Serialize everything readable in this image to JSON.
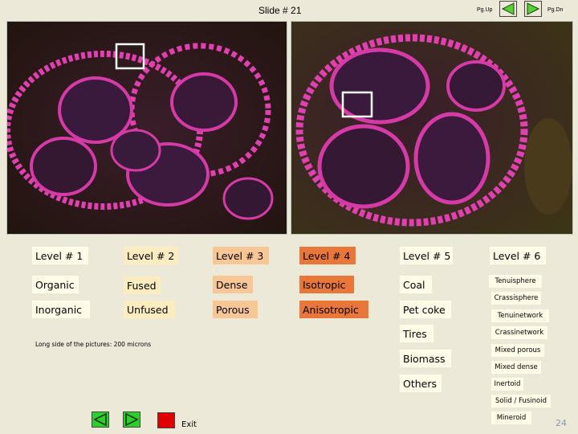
{
  "slide_title": "Slide  # 21",
  "nav": {
    "pgup_label": "Pg.Up",
    "pgdn_label": "Pg.Dn",
    "exit_label": "Exit"
  },
  "levels": [
    {
      "header": "Level # 1",
      "items": [
        "Organic",
        "Inorganic"
      ]
    },
    {
      "header": "Level # 2",
      "items": [
        "Fused",
        "Unfused"
      ]
    },
    {
      "header": "Level # 3",
      "items": [
        "Dense",
        "Porous"
      ]
    },
    {
      "header": "Level # 4",
      "items": [
        "Isotropic",
        "Anisotropic"
      ]
    },
    {
      "header": "Level # 5",
      "items": [
        "Coal",
        "Pet coke",
        "Tires",
        "Biomass",
        "Others"
      ]
    },
    {
      "header": "Level # 6",
      "items": [
        "Tenuisphere",
        "Crassisphere",
        "Tenuinetwork",
        "Crassinetwork",
        "Mixed porous",
        "Mixed dense",
        "Inertoid",
        "Solid / Fusinoid",
        "Mineroid"
      ]
    }
  ],
  "caption": "Long side of the pictures: 200 microns",
  "page_number": "24",
  "colors": {
    "level1": "#fffde8",
    "level2": "#fdecc0",
    "level3": "#f9c796",
    "level4": "#e9773a",
    "nav_green": "#2bd02b",
    "exit_red": "#e00000",
    "stain": "#e23fb0"
  },
  "icons": {
    "prev": "left-triangle-icon",
    "next": "right-triangle-icon",
    "exit": "red-square-icon"
  }
}
